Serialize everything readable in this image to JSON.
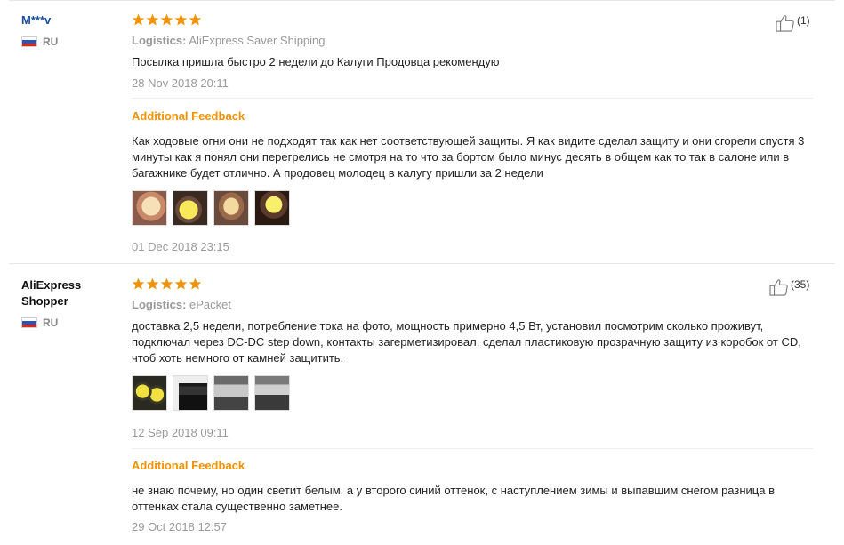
{
  "reviews": [
    {
      "user": "M***v",
      "country": "RU",
      "rating": 5,
      "likes": "(1)",
      "logistics_label": "Logistics:",
      "logistics_value": "AliExpress Saver Shipping",
      "text": "Посылка пришла быстро 2 недели до Калуги Продовца рекомендую",
      "date": "28 Nov 2018 20:11",
      "additional_label": "Additional Feedback",
      "additional_text": "Как ходовые огни они не подходят так как нет соответствующей защиты. Я как видите сделал защиту и они сгорели спустя 3 минуты как я понял они перегрелись не смотря на то что за бортом было минус десять в общем как то так в салоне или в багажнике будет отлично. А продовец молодец в калугу пришли за 2 недели",
      "additional_date": "01 Dec 2018 23:15",
      "photo_count": 4
    },
    {
      "user": "AliExpress Shopper",
      "country": "RU",
      "rating": 5,
      "likes": "(35)",
      "logistics_label": "Logistics:",
      "logistics_value": "ePacket",
      "text": "доставка 2,5 недели, потребление тока на фото, мощность примерно 4,5 Вт, установил посмотрим сколько проживут, подключал через DC-DC step down, контакты загерметизировал, сделал пластиковую прозрачную защиту из коробок от CD, чтоб хоть немного от камней защитить.",
      "date": "12 Sep 2018 09:11",
      "additional_label": "Additional Feedback",
      "additional_text": "не знаю почему, но один светит белым, а у второго синий оттенок, с наступлением зимы и выпавшим снегом разница в оттенках стала существенно заметнее.",
      "additional_date": "29 Oct 2018 12:57",
      "photo_count": 4
    }
  ],
  "colors": {
    "accent_orange": "#f29200",
    "star": "#f29200",
    "username_blue": "#1a4fa3",
    "muted": "#999999"
  },
  "icons": [
    "star-icon",
    "thumbs-up-icon",
    "russia-flag-icon"
  ]
}
